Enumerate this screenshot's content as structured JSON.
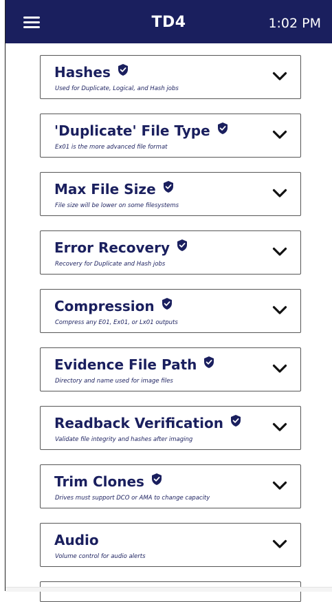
{
  "header": {
    "title": "TD4",
    "time": "1:02 PM",
    "menu_icon": "hamburger-menu-icon",
    "background_color": "#1a1f5e"
  },
  "settings": [
    {
      "title": "Hashes",
      "description": "Used for Duplicate, Logical, and Hash jobs"
    },
    {
      "title": "'Duplicate' File Type",
      "description": "Ex01 is the more advanced file format"
    },
    {
      "title": "Max File Size",
      "description": "File size will be lower on some filesystems"
    },
    {
      "title": "Error Recovery",
      "description": "Recovery for Duplicate and Hash jobs"
    },
    {
      "title": "Compression",
      "description": "Compress any E01, Ex01, or Lx01 outputs"
    },
    {
      "title": "Evidence File Path",
      "description": "Directory and name used for image files"
    },
    {
      "title": "Readback Verification",
      "description": "Validate file integrity and hashes after imaging"
    },
    {
      "title": "Trim Clones",
      "description": "Drives must support DCO or AMA to change capacity"
    },
    {
      "title": "Audio",
      "description": "Volume control for audio alerts"
    }
  ],
  "icons": {
    "badge": "shield-check-icon",
    "expand": "chevron-down-icon"
  },
  "colors": {
    "accent": "#1a1f5e",
    "text_on_header": "#ffffff"
  }
}
